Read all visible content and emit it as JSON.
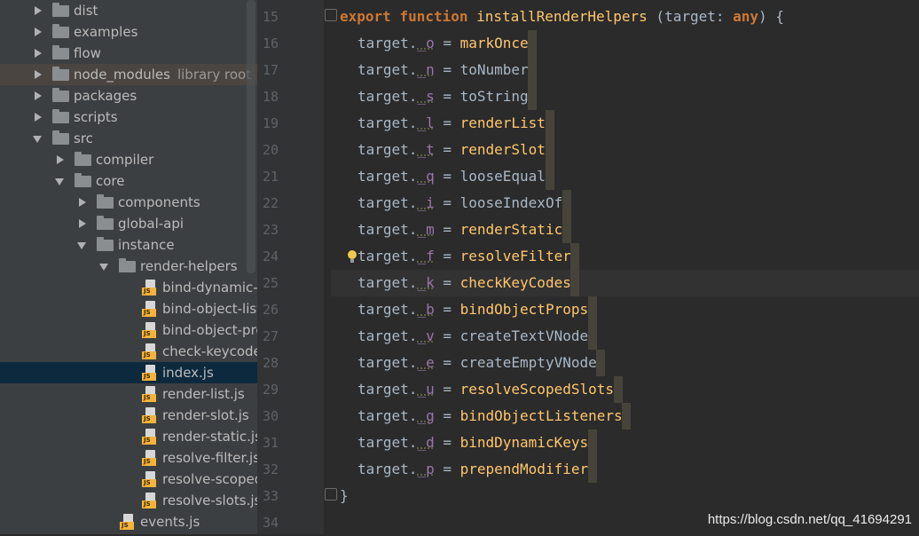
{
  "project_tree": {
    "items": [
      {
        "label": "dist",
        "kind": "folder",
        "state": "collapsed",
        "level": 1
      },
      {
        "label": "examples",
        "kind": "folder",
        "state": "collapsed",
        "level": 1
      },
      {
        "label": "flow",
        "kind": "folder",
        "state": "collapsed",
        "level": 1
      },
      {
        "label": "node_modules",
        "kind": "folder",
        "state": "collapsed",
        "level": 1,
        "suffix": "library root",
        "highlight": true
      },
      {
        "label": "packages",
        "kind": "folder",
        "state": "collapsed",
        "level": 1
      },
      {
        "label": "scripts",
        "kind": "folder",
        "state": "collapsed",
        "level": 1
      },
      {
        "label": "src",
        "kind": "folder",
        "state": "expanded",
        "level": 1
      },
      {
        "label": "compiler",
        "kind": "folder",
        "state": "collapsed",
        "level": 2
      },
      {
        "label": "core",
        "kind": "folder",
        "state": "expanded",
        "level": 2
      },
      {
        "label": "components",
        "kind": "folder",
        "state": "collapsed",
        "level": 3
      },
      {
        "label": "global-api",
        "kind": "folder",
        "state": "collapsed",
        "level": 3
      },
      {
        "label": "instance",
        "kind": "folder",
        "state": "expanded",
        "level": 3
      },
      {
        "label": "render-helpers",
        "kind": "folder",
        "state": "expanded",
        "level": 4
      },
      {
        "label": "bind-dynamic-keys.js",
        "kind": "file",
        "level": 5
      },
      {
        "label": "bind-object-listeners.js",
        "kind": "file",
        "level": 5
      },
      {
        "label": "bind-object-props.js",
        "kind": "file",
        "level": 5
      },
      {
        "label": "check-keycodes.js",
        "kind": "file",
        "level": 5
      },
      {
        "label": "index.js",
        "kind": "file",
        "level": 5,
        "selected": true
      },
      {
        "label": "render-list.js",
        "kind": "file",
        "level": 5
      },
      {
        "label": "render-slot.js",
        "kind": "file",
        "level": 5
      },
      {
        "label": "render-static.js",
        "kind": "file",
        "level": 5
      },
      {
        "label": "resolve-filter.js",
        "kind": "file",
        "level": 5
      },
      {
        "label": "resolve-scoped-slots.js",
        "kind": "file",
        "level": 5
      },
      {
        "label": "resolve-slots.js",
        "kind": "file",
        "level": 5
      },
      {
        "label": "events.js",
        "kind": "file",
        "level": 4
      }
    ]
  },
  "editor": {
    "line_numbers": [
      "15",
      "16",
      "17",
      "18",
      "19",
      "20",
      "21",
      "22",
      "23",
      "24",
      "25",
      "26",
      "27",
      "28",
      "29",
      "30",
      "31",
      "32",
      "33",
      "34"
    ],
    "header": {
      "kw_export": "export",
      "kw_function": "function",
      "fn_name": "installRenderHelpers",
      "paren_open": " (",
      "param": "target",
      "colon": ": ",
      "type": "any",
      "close": ") {"
    },
    "assign_lines": [
      {
        "prop": "_o",
        "value": "markOnce",
        "color": "fn"
      },
      {
        "prop": "_n",
        "value": "toNumber",
        "color": "plain"
      },
      {
        "prop": "_s",
        "value": "toString",
        "color": "plain"
      },
      {
        "prop": "_l",
        "value": "renderList",
        "color": "fn"
      },
      {
        "prop": "_t",
        "value": "renderSlot",
        "color": "fn"
      },
      {
        "prop": "_q",
        "value": "looseEqual",
        "color": "plain"
      },
      {
        "prop": "_i",
        "value": "looseIndexOf",
        "color": "plain"
      },
      {
        "prop": "_m",
        "value": "renderStatic",
        "color": "fn"
      },
      {
        "prop": "_f",
        "value": "resolveFilter",
        "color": "fn"
      },
      {
        "prop": "_k",
        "value": "checkKeyCodes",
        "color": "fn"
      },
      {
        "prop": "_b",
        "value": "bindObjectProps",
        "color": "fn"
      },
      {
        "prop": "_v",
        "value": "createTextVNode",
        "color": "plain"
      },
      {
        "prop": "_e",
        "value": "createEmptyVNode",
        "color": "plain"
      },
      {
        "prop": "_u",
        "value": "resolveScopedSlots",
        "color": "fn"
      },
      {
        "prop": "_g",
        "value": "bindObjectListeners",
        "color": "fn"
      },
      {
        "prop": "_d",
        "value": "bindDynamicKeys",
        "color": "fn"
      },
      {
        "prop": "_p",
        "value": "prependModifier",
        "color": "fn"
      }
    ],
    "target_word": "target.",
    "equals": " = ",
    "closing_brace": "}"
  },
  "watermark": "https://blog.csdn.net/qq_41694291",
  "colors": {
    "keyword": "#cc7832",
    "function": "#ffc66d",
    "property": "#9876aa",
    "text": "#a9b7c6"
  }
}
